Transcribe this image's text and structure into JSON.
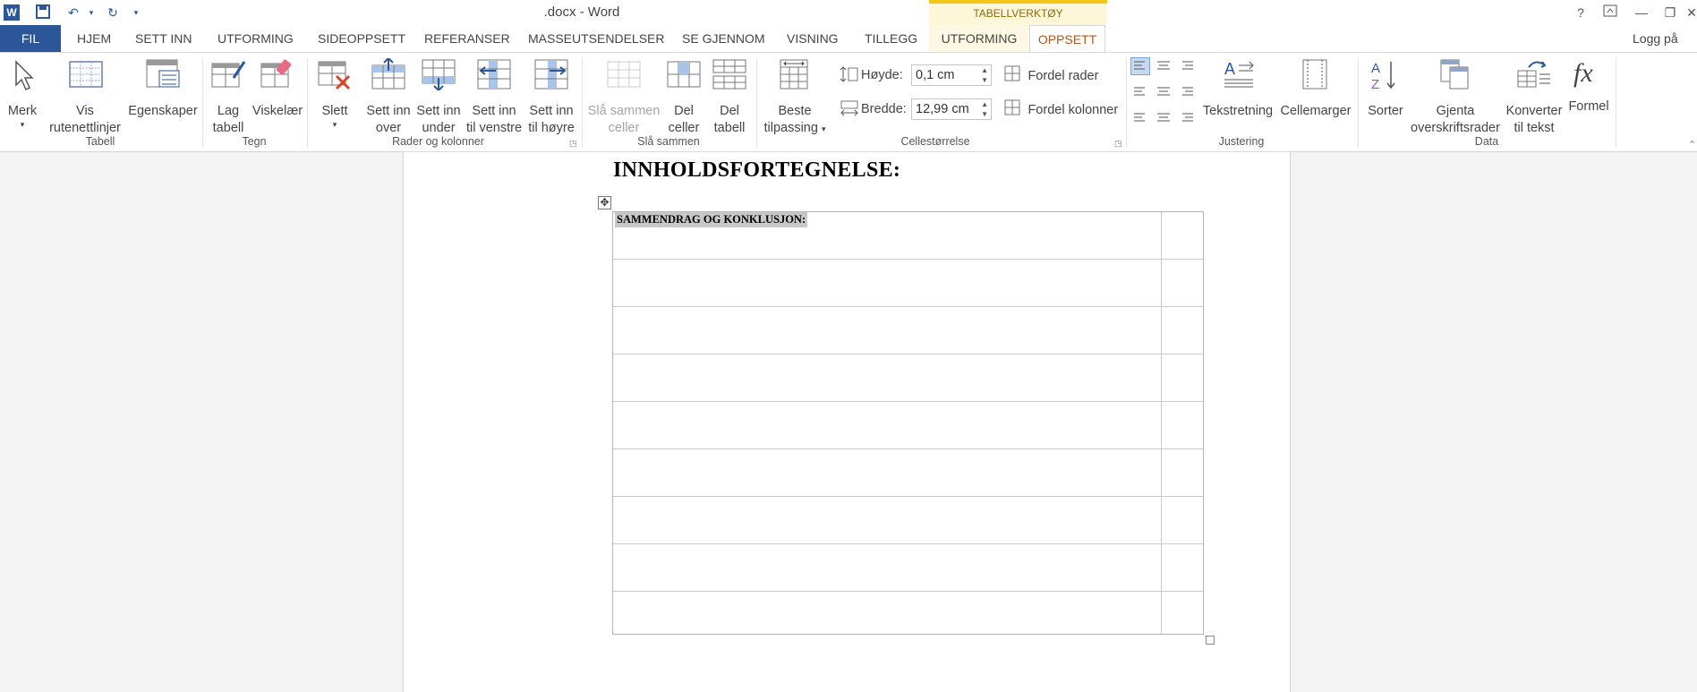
{
  "window": {
    "title": ".docx - Word",
    "context_tab_header": "TABELLVERKTØY",
    "help": "?",
    "login": "Logg på"
  },
  "tabs": {
    "fil": "FIL",
    "hjem": "HJEM",
    "sett_inn": "SETT INN",
    "utforming": "UTFORMING",
    "sideoppsett": "SIDEOPPSETT",
    "referanser": "REFERANSER",
    "masseutsendelser": "MASSEUTSENDELSER",
    "se_gjennom": "SE GJENNOM",
    "visning": "VISNING",
    "tillegg": "TILLEGG",
    "ctx_utforming": "UTFORMING",
    "ctx_oppsett": "OPPSETT"
  },
  "ribbon": {
    "tabell": {
      "label": "Tabell",
      "merk": "Merk",
      "vis": "Vis",
      "rutenettlinjer": "rutenettlinjer",
      "egenskaper": "Egenskaper"
    },
    "tegn": {
      "label": "Tegn",
      "lag": "Lag",
      "tabell": "tabell",
      "viskelaer": "Viskelær"
    },
    "rader": {
      "label": "Rader og kolonner",
      "slett": "Slett",
      "sett_inn": "Sett inn",
      "over": "over",
      "under": "under",
      "til_venstre": "til venstre",
      "til_hoyre": "til høyre"
    },
    "sla_sammen": {
      "label": "Slå sammen",
      "sla_sammen": "Slå sammen",
      "celler": "celler",
      "del": "Del",
      "tabell": "tabell"
    },
    "cellestorrelse": {
      "label": "Cellestørrelse",
      "beste": "Beste",
      "tilpassing": "tilpassing",
      "hoyde_label": "Høyde:",
      "hoyde_value": "0,1 cm",
      "bredde_label": "Bredde:",
      "bredde_value": "12,99 cm",
      "fordel_rader": "Fordel rader",
      "fordel_kolonner": "Fordel kolonner"
    },
    "justering": {
      "label": "Justering",
      "tekstretning": "Tekstretning",
      "cellemarger": "Cellemarger"
    },
    "data": {
      "label": "Data",
      "sorter": "Sorter",
      "gjenta": "Gjenta",
      "overskriftsrader": "overskriftsrader",
      "konverter": "Konverter",
      "til_tekst": "til tekst",
      "formel": "Formel"
    }
  },
  "document": {
    "heading": "INNHOLDSFORTEGNELSE:",
    "first_cell_text": "SAMMENDRAG OG KONKLUSJON:"
  }
}
